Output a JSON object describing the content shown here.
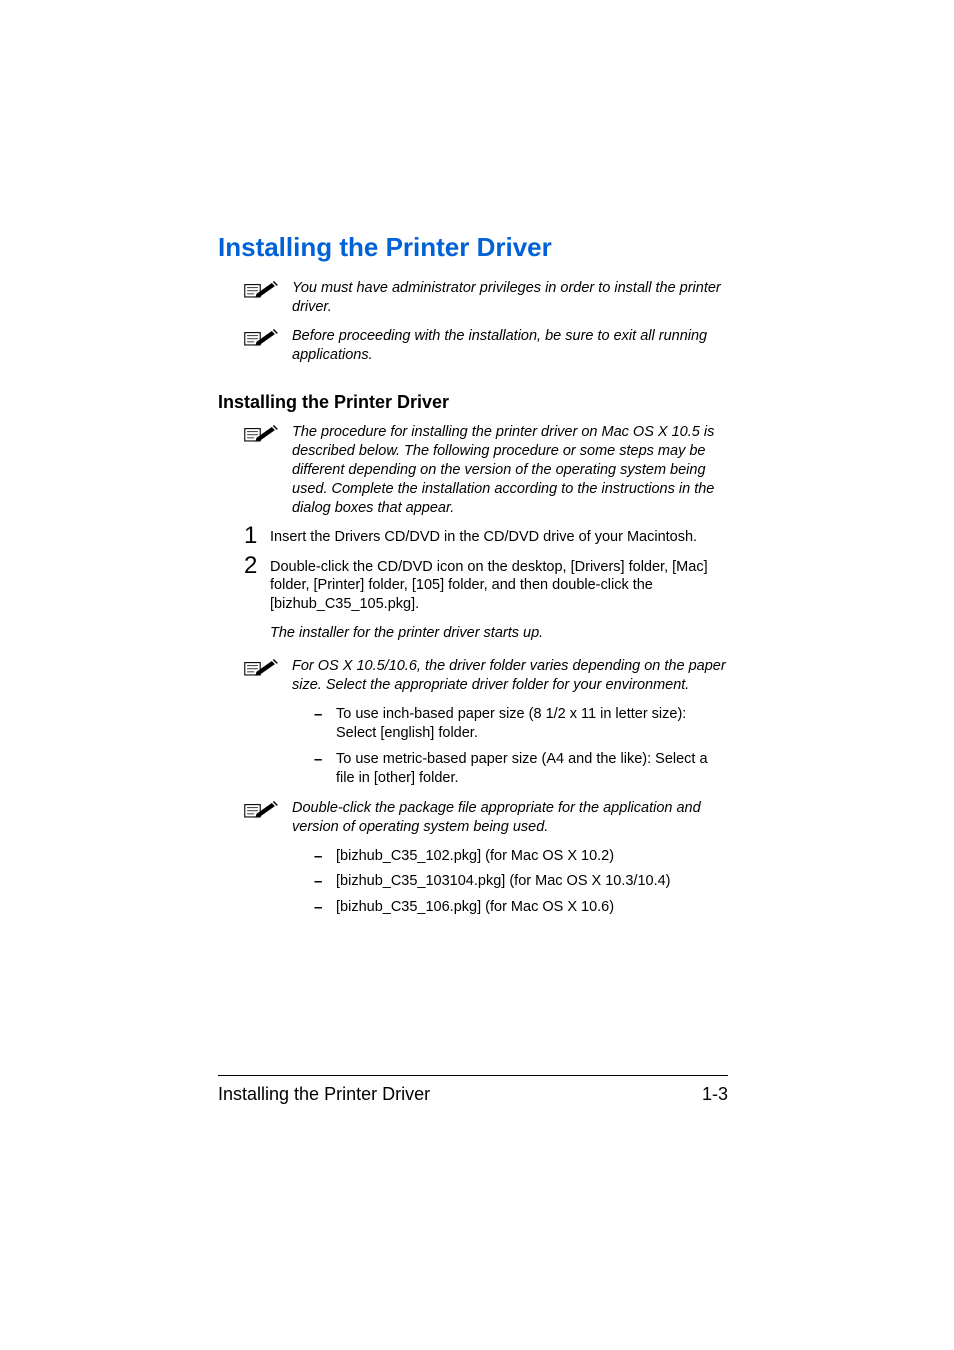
{
  "heading": "Installing the Printer Driver",
  "notes_top": [
    "You must have administrator privileges in order to install the printer driver.",
    "Before proceeding with the installation, be sure to exit all running applications."
  ],
  "subheading": "Installing the Printer Driver",
  "sub_note": "The procedure for installing the printer driver on Mac OS X 10.5 is described below. The following procedure or some steps may be different depending on the version of the operating system being used. Complete the installation according to the instructions in the dialog boxes that appear.",
  "steps": [
    {
      "n": "1",
      "text": "Insert the Drivers CD/DVD in the CD/DVD drive of your Macintosh."
    },
    {
      "n": "2",
      "text": "Double-click the CD/DVD icon on the desktop, [Drivers] folder, [Mac] folder, [Printer] folder, [105] folder, and then double-click the [bizhub_C35_105.pkg]."
    }
  ],
  "step_after_italic": "The installer for the printer driver starts up.",
  "notes_mid": [
    "For OS X 10.5/10.6, the driver folder varies depending on the paper size. Select the appropriate driver folder for your environment."
  ],
  "paper_list": [
    "To use inch-based paper size (8 1/2 x 11 in letter size): Select [english] folder.",
    "To use metric-based paper size (A4 and the like): Select a file in [other] folder."
  ],
  "notes_bottom": [
    "Double-click the package file appropriate for the application and version of operating system being used."
  ],
  "pkg_list": [
    "[bizhub_C35_102.pkg] (for Mac OS X 10.2)",
    "[bizhub_C35_103104.pkg] (for Mac OS X 10.3/10.4)",
    "[bizhub_C35_106.pkg] (for Mac OS X 10.6)"
  ],
  "footer_left": "Installing the Printer Driver",
  "footer_right": "1-3"
}
